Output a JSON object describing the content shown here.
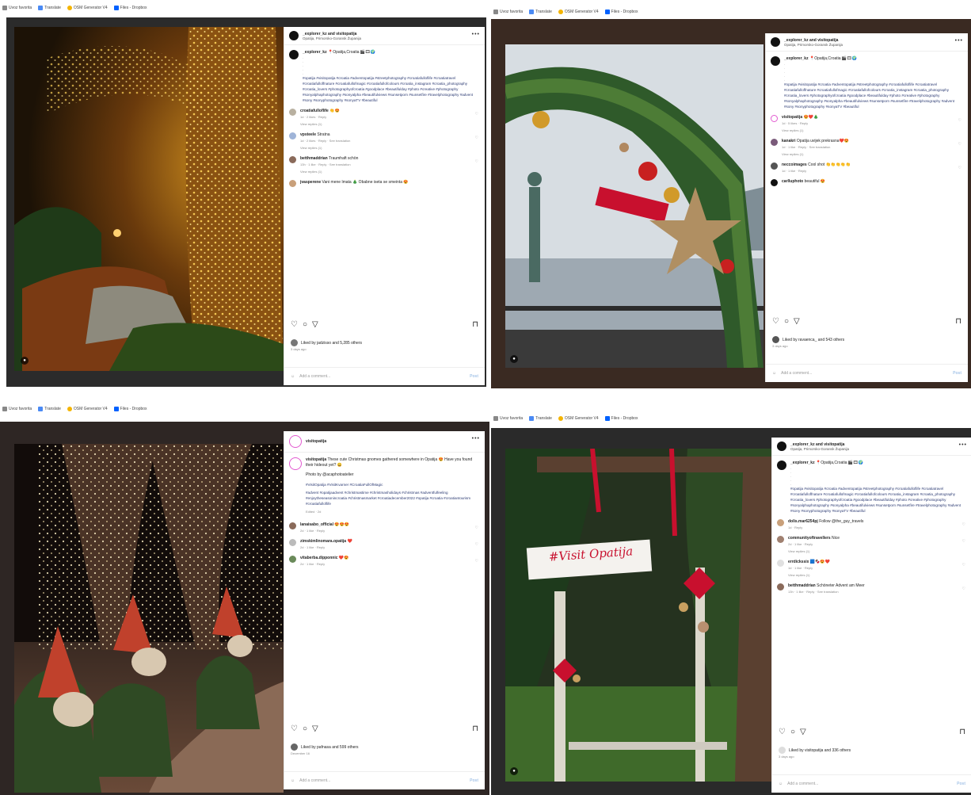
{
  "bookmarks": [
    {
      "label": "Uvoz favorita",
      "color": "#888888"
    },
    {
      "label": "Translate",
      "color": "#4a8af4"
    },
    {
      "label": "OSM Generator V4",
      "color": "#f4b400"
    },
    {
      "label": "Files - Dropbox",
      "color": "#0061fe"
    }
  ],
  "post1": {
    "author": "_explorer_kz and visitopatija",
    "location": "Opatija, Primorsko-Goransk Županija",
    "caption_user": "_explorer_kz",
    "caption_text": "📍Opatija,Croatia 🎬🎞🌍",
    "hashtags": "#opatija #visitopatija #croatia #adventopatija #streetphotography #croatiafulloflife #croatiatravel #croatiafulloffnature #croatiafullofmagic #croatiafullofcolours #croatia_instagram #croatia_photography #croatia_lovers #photographyofcroatia #goodplace #beautifulday #photo #creative #photography #sonyalphaphotography #sonyalpha #beautifulviews #sunsetporn #sunsetfire #travelphotography #advent #sony #sonyphotography #sonyaTV #beautiful",
    "comments": [
      {
        "user": "croatiafulloflife",
        "text": "👏😍",
        "meta": "1d · 2 likes · Reply",
        "replies": "View replies (1)"
      },
      {
        "user": "vpsteele",
        "text": "Stratna",
        "meta": "1d · 2 likes · Reply · See translation",
        "replies": "View replies (1)"
      },
      {
        "user": "betthmaddrian",
        "text": "Traumhaft schön",
        "meta": "13h · 1 like · Reply · See translation",
        "replies": "View replies (1)"
      },
      {
        "user": "jvasperene",
        "text": "Vani mene lmata 🎄 Obabne iseta se smeinta 😍",
        "meta": "",
        "replies": ""
      }
    ],
    "likes": "Liked by jadzisso and 5,285 others",
    "date": "3 days ago",
    "add_placeholder": "Add a comment...",
    "post_label": "Post"
  },
  "post2": {
    "author": "_explorer_kz and visitopatija",
    "location": "Opatija, Primorsko-Goransk Županija",
    "caption_user": "_explorer_kz",
    "caption_text": "📍Opatija,Croatia 🎬🎞🌍",
    "hashtags": "#opatija #visitopatija #croatia #adventopatija #streetphotography #croatiafulloflife #croatiatravel #croatiafulloffnature #croatiafullofmagic #croatiafullofcolours #croatia_instagram #croatia_photography #croatia_lovers #photographyofcroatia #goodplace #beautifulday #photo #creative #photography #sonyalphaphotography #sonyalpha #beautifulviews #sunsetporn #sunsetfire #travelphotography #advent #sony #sonyphotography #sonyaTV #beautiful",
    "comments": [
      {
        "user": "visitopatija",
        "text": "😍❤️🎄",
        "meta": "1d · 5 likes · Reply",
        "replies": "View replies (1)"
      },
      {
        "user": "kanakri",
        "text": "Opatija uvijek prekrasna❤️😍",
        "meta": "1d · 1 like · Reply · See translation",
        "replies": "View replies (1)"
      },
      {
        "user": "neccoimages",
        "text": "Cool shot 👏👏👏👏👏",
        "meta": "1d · 1 like · Reply",
        "replies": ""
      },
      {
        "user": "carlluphoto",
        "text": "beautiful 😍",
        "meta": "",
        "replies": ""
      }
    ],
    "likes": "Liked by ravaenca_ and 543 others",
    "date": "3 days ago",
    "add_placeholder": "Add a comment...",
    "post_label": "Post"
  },
  "post3": {
    "author": "visitopatija",
    "caption_user": "visitopatija",
    "caption_text": "These cute Christmas gnomes gathered somewhere in Opatija 😍 Have you found their hideout yet? 😄",
    "credit": "Photo by @acaphotoatelier",
    "tags1": "#VisitOpatija #VisitKvarner #CroatiaFullOfMagic",
    "tags2": "#advent #opatijaadvent #christmastime #christmasholidays #christmas #adventfulfeeling #enjoytheseasonincroatia #christmasmarket #croatiadecember2022 #opatija #croatia #croatiantourism #croatiafulloflife",
    "edited": "Edited · 2d",
    "comments": [
      {
        "user": "lanaisabo_official",
        "text": "😍😍😍",
        "meta": "2d · 1 like · Reply",
        "replies": ""
      },
      {
        "user": "zimskimlinomara.opatija",
        "text": "❤️",
        "meta": "2d · 1 like · Reply",
        "replies": ""
      },
      {
        "user": "vitaberba.dipponnic",
        "text": "❤️😍",
        "meta": "2d · 1 like · Reply",
        "replies": ""
      }
    ],
    "likes": "Liked by pafnasa and 599 others",
    "date": "December 16",
    "add_placeholder": "Add a comment...",
    "post_label": "Post"
  },
  "post4": {
    "author": "_explorer_kz and visitopatija",
    "location": "Opatija, Primorsko-Goransk Županija",
    "caption_user": "_explorer_kz",
    "caption_text": "📍Opatija,Croatia 🎬🎞🌍",
    "hashtags": "#opatija #visitopatija #croatia #adventopatija #streetphotography #croatiafulloflife #croatiatravel #croatiafulloffnature #croatiafullofmagic #croatiafullofcolours #croatia_instagram #croatia_photography #croatia_lovers #photographyofcroatia #goodplace #beautifulday #photo #creative #photography #sonyalphaphotography #sonyalpha #beautifulviews #sunsetporn #sunsetfire #travelphotography #advent #sony #sonyphotography #sonyaTV #beautiful",
    "comments": [
      {
        "user": "dolis.mar6254pj",
        "text": "Follow @the_guy_travels",
        "meta": "1d · Reply",
        "replies": ""
      },
      {
        "user": "communityoftravellers",
        "text": "Nice",
        "meta": "2d · 1 like · Reply",
        "replies": "View replies (1)"
      },
      {
        "user": "errdickssix",
        "text": "🟦🍫😍❤️",
        "meta": "1d · 1 like · Reply",
        "replies": "View replies (1)"
      },
      {
        "user": "betthmaddrian",
        "text": "Schöneter Advent am Meer",
        "meta": "13h · 1 like · Reply · See translation",
        "replies": ""
      }
    ],
    "likes": "Liked by visitopatija and 336 others",
    "date": "3 days ago",
    "add_placeholder": "Add a comment...",
    "post_label": "Post"
  }
}
